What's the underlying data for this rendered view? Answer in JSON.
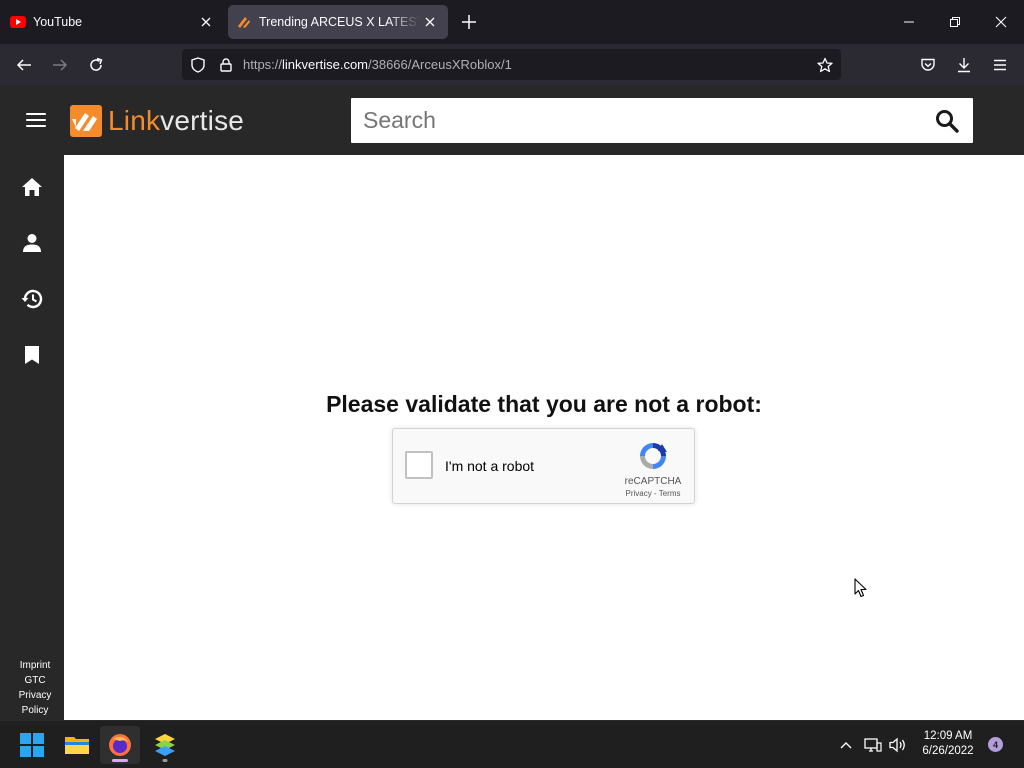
{
  "browser": {
    "tabs": [
      {
        "title": "YouTube",
        "favicon": "youtube-icon"
      },
      {
        "title": "Trending ARCEUS X LATEST VERSION",
        "favicon": "linkvertise-favicon",
        "active": true
      }
    ],
    "url_prefix": "https://",
    "url_domain": "linkvertise.com",
    "url_path": "/38666/ArceusXRoblox/1"
  },
  "site": {
    "logo_word_1": "Link",
    "logo_word_2": "vertise",
    "search_placeholder": "Search",
    "brand_color": "#f58c2c"
  },
  "sidebar": {
    "items": [
      {
        "icon": "home-icon"
      },
      {
        "icon": "person-icon"
      },
      {
        "icon": "history-icon"
      },
      {
        "icon": "bookmark-icon"
      }
    ],
    "footer_links": [
      "Imprint",
      "GTC",
      "Privacy Policy"
    ]
  },
  "main": {
    "prompt": "Please validate that you are not a robot:",
    "captcha": {
      "label": "I'm not a robot",
      "brand": "reCAPTCHA",
      "links": "Privacy - Terms"
    }
  },
  "taskbar": {
    "time": "12:09 AM",
    "date": "6/26/2022",
    "notification_count": "4"
  }
}
